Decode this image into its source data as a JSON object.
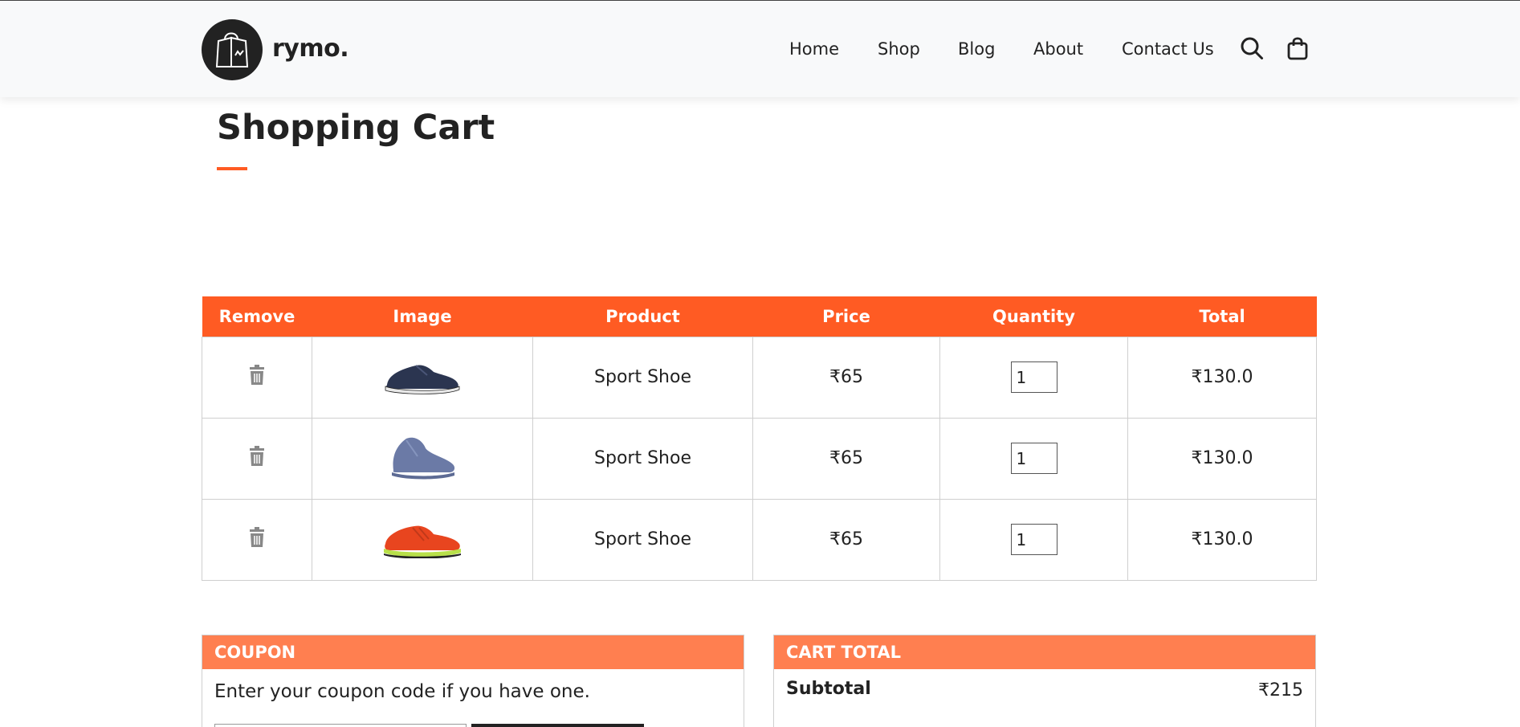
{
  "header": {
    "brand": "rymo.",
    "nav": [
      "Home",
      "Shop",
      "Blog",
      "About",
      "Contact Us"
    ],
    "icons": [
      "search-icon",
      "shopping-bag-icon"
    ]
  },
  "page": {
    "title": "Shopping Cart"
  },
  "cart": {
    "columns": [
      "Remove",
      "Image",
      "Product",
      "Price",
      "Quantity",
      "Total"
    ],
    "rows": [
      {
        "image": "navy-sport-shoe",
        "product": "Sport Shoe",
        "price": "₹65",
        "quantity": "1",
        "total": "₹130.0"
      },
      {
        "image": "blue-grey-sport-shoe",
        "product": "Sport Shoe",
        "price": "₹65",
        "quantity": "1",
        "total": "₹130.0"
      },
      {
        "image": "orange-sport-shoe",
        "product": "Sport Shoe",
        "price": "₹65",
        "quantity": "1",
        "total": "₹130.0"
      }
    ]
  },
  "coupon": {
    "heading": "COUPON",
    "description": "Enter your coupon code if you have one."
  },
  "cart_total": {
    "heading": "CART TOTAL",
    "subtotal_label": "Subtotal",
    "subtotal_value": "₹215"
  },
  "colors": {
    "accent": "#ff5b23",
    "accent_light": "#ff7f50",
    "dark": "#222222"
  }
}
